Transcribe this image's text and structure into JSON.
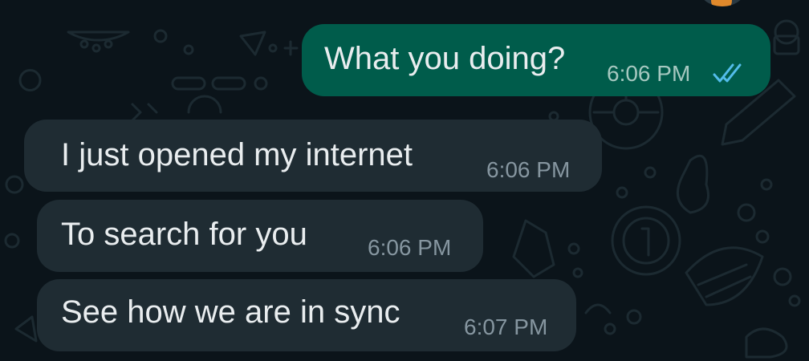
{
  "messages": [
    {
      "direction": "outgoing",
      "text": "What you doing?",
      "time": "6:06 PM",
      "status": "read"
    },
    {
      "direction": "incoming",
      "text": "I just opened my internet",
      "time": "6:06 PM"
    },
    {
      "direction": "incoming",
      "text": "To search for you",
      "time": "6:06 PM"
    },
    {
      "direction": "incoming",
      "text": "See how we are in sync",
      "time": "6:07 PM"
    }
  ],
  "colors": {
    "background": "#0b141a",
    "outgoing_bubble": "#005c4b",
    "incoming_bubble": "#1f2c33",
    "message_text": "#e9edef",
    "timestamp": "#8696a0",
    "read_ticks": "#53bdeb"
  },
  "icons": {
    "read_receipt": "double-check-icon"
  }
}
